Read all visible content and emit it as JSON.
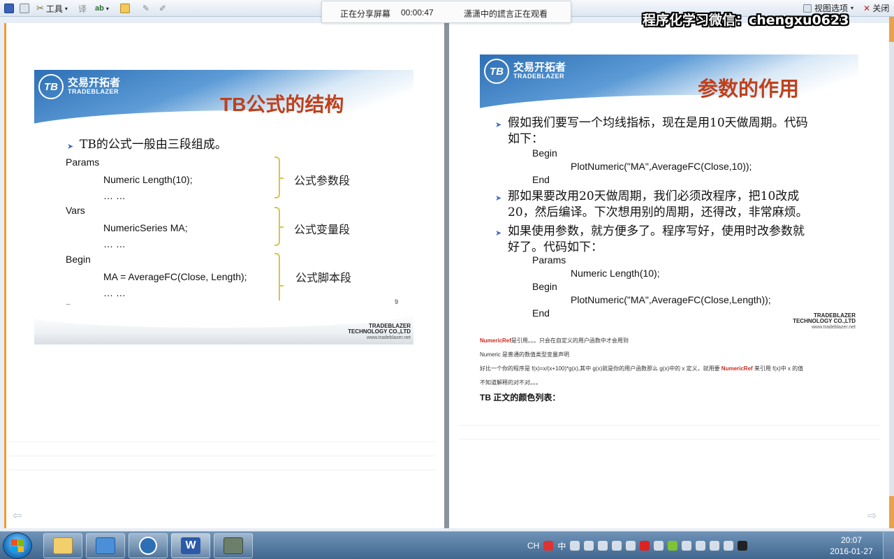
{
  "toolbar": {
    "tools_label": "工具",
    "spell_label": "ab",
    "view_options_label": "视图选项",
    "close_label": "关闭"
  },
  "share_banner": {
    "status": "正在分享屏幕",
    "timer": "00:00:47",
    "viewer": "潇潇中的謊言正在观看"
  },
  "watermark": "程序化学习微信：chengxu0623",
  "left_slide": {
    "logo_cn": "交易开拓者",
    "logo_en": "TRADEBLAZER",
    "logo_mark": "TB",
    "title": "TB公式的结构",
    "bullet": "TB的公式一般由三段组成。",
    "lines": {
      "params": "Params",
      "params_code": "Numeric Length(10);",
      "params_ellipsis": "… …",
      "vars": "Vars",
      "vars_code": "NumericSeries MA;",
      "vars_ellipsis": "… …",
      "begin": "Begin",
      "begin_code": "MA = AverageFC(Close, Length);",
      "begin_ellipsis": "… …",
      "end": "End"
    },
    "sections": [
      "公式参数段",
      "公式变量段",
      "公式脚本段"
    ],
    "page_number": "9",
    "footer_line1": "TRADEBLAZER",
    "footer_line2": "TECHNOLOGY CO.,LTD",
    "footer_url": "www.tradeblazer.net"
  },
  "right_slide": {
    "logo_cn": "交易开拓者",
    "logo_en": "TRADEBLAZER",
    "logo_mark": "TB",
    "title": "参数的作用",
    "bullet1_line1": "假如我们要写一个均线指标，现在是用10天做周期。代码",
    "bullet1_line2": "如下：",
    "code1": {
      "begin": "Begin",
      "plot": "PlotNumeric(\"MA\",AverageFC(Close,10));",
      "end": "End"
    },
    "bullet2_line1": "那如果要改用20天做周期，我们必须改程序，把10改成",
    "bullet2_line2": "20，然后编译。下次想用别的周期，还得改，非常麻烦。",
    "bullet3_line1": "如果使用参数，就方便多了。程序写好，使用时改参数就",
    "bullet3_line2": "好了。代码如下：",
    "code2": {
      "params": "Params",
      "numeric": "Numeric Length(10);",
      "begin": "Begin",
      "plot": "PlotNumeric(\"MA\",AverageFC(Close,Length));",
      "end": "End"
    },
    "footer_line1": "TRADEBLAZER",
    "footer_line2": "TECHNOLOGY CO.,LTD",
    "footer_url": "www.tradeblazer.net"
  },
  "notes": {
    "line1_ref": "NumericRef",
    "line1_rest": "是引用。。。只会在自定义的用户函数中才会用到",
    "line2": "Numeric 是普通的数值类型变量声明",
    "line3_a": "好比一个你的程序是 f(x)=x/(x+100)*g(x),其中 g(x)就是你的用户函数那么 g(x)中的 x 定义，就用要 ",
    "line3_ref": "NumericRef",
    "line3_b": " 来引用 f(x)中 x 的值",
    "line4": "不知道解释的对不对。。。",
    "color_heading": "TB 正文的颜色列表："
  },
  "taskbar": {
    "tray_lang": "CH",
    "tray_ime": "中",
    "time": "20:07",
    "date": "2016-01-27"
  },
  "colors": {
    "accent_orange": "#f29a2e",
    "title_red": "#c0401b",
    "brand_blue": "#2d6fb5",
    "ref_red": "#cc2a1f"
  }
}
